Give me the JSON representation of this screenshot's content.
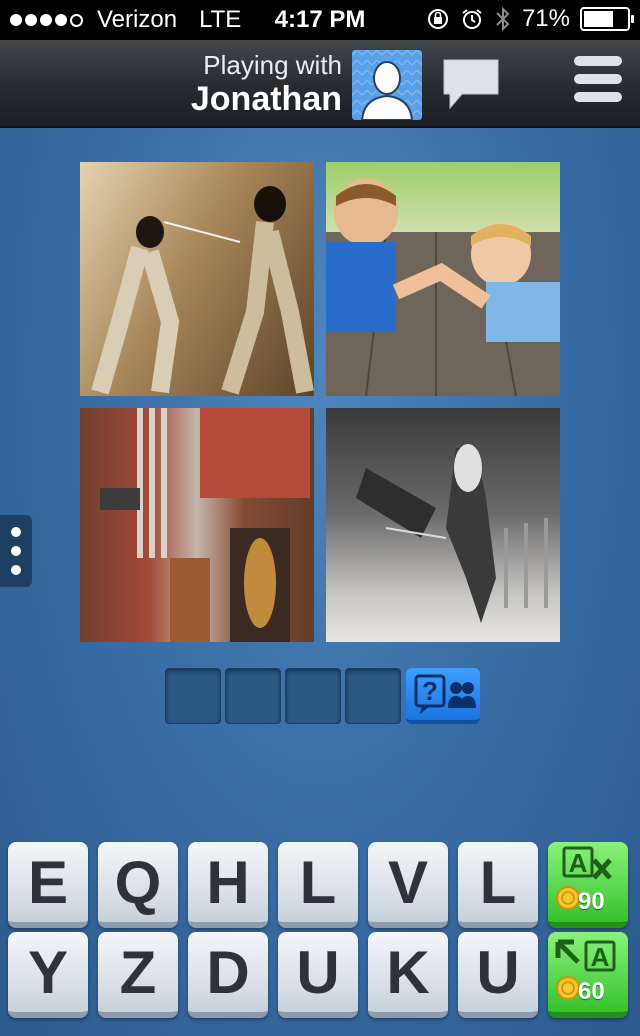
{
  "status_bar": {
    "carrier": "Verizon",
    "network": "LTE",
    "time": "4:17 PM",
    "battery": "71%",
    "battery_level": 0.71,
    "signal_bars": 4
  },
  "header": {
    "playing_label": "Playing with",
    "opponent_name": "Jonathan",
    "icons": [
      "avatar-icon",
      "chat-icon",
      "menu-icon"
    ]
  },
  "puzzle": {
    "photos": [
      "fencing-photo",
      "arm-wrestling-photo",
      "cowboys-photo",
      "horse-rider-fall-photo"
    ],
    "answer_length": 4,
    "answer_slots": [
      "",
      "",
      "",
      ""
    ]
  },
  "keyboard": {
    "row1": [
      "E",
      "Q",
      "H",
      "L",
      "V",
      "L"
    ],
    "row2": [
      "Y",
      "Z",
      "D",
      "U",
      "K",
      "U"
    ]
  },
  "powerups": {
    "remove_letters_cost": "90",
    "reveal_letter_cost": "60"
  },
  "colors": {
    "background": "#3a6fa6",
    "key_face": "#e4e9ee",
    "powerup_green": "#36c22e",
    "hint_blue": "#1a73e0"
  }
}
